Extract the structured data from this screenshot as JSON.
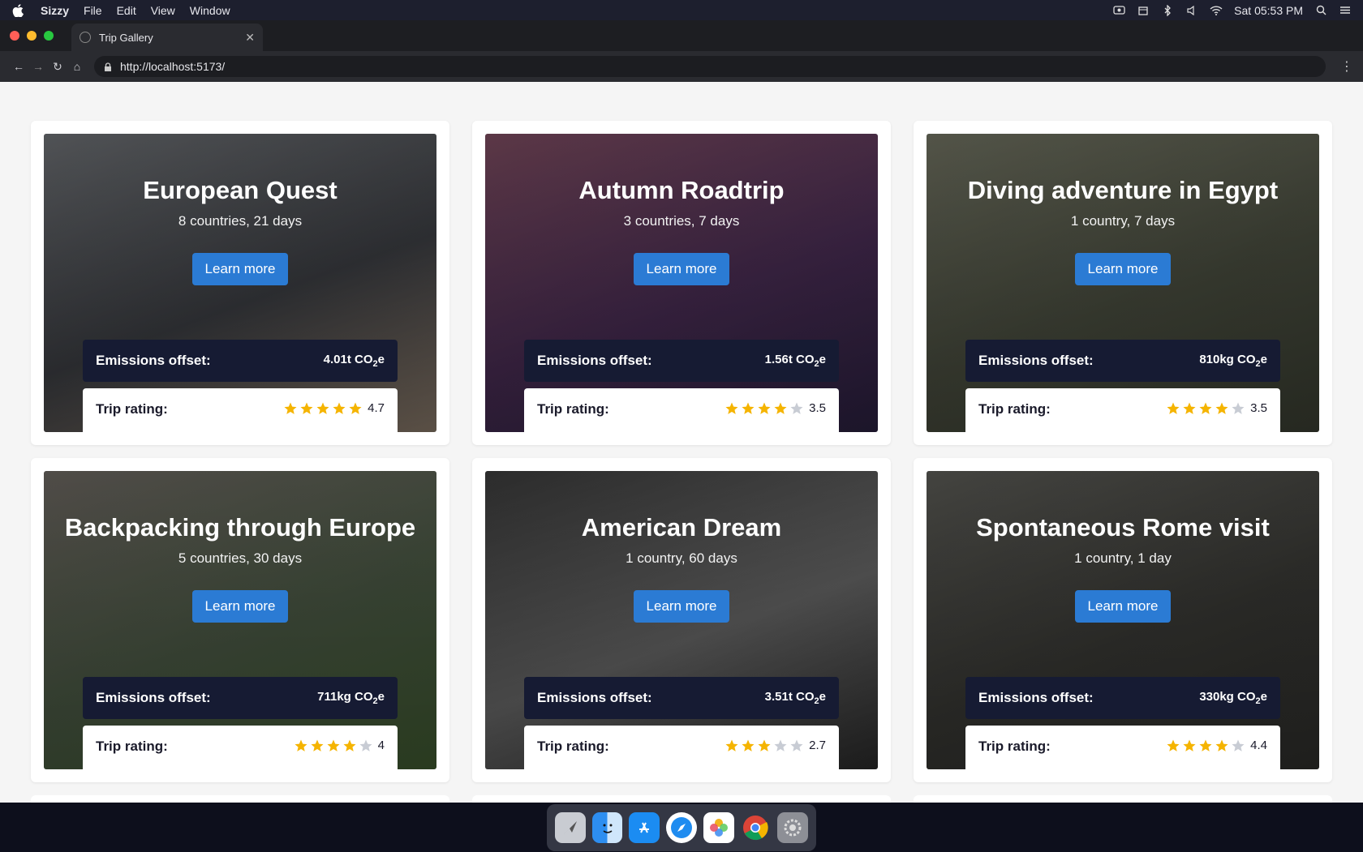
{
  "menubar": {
    "app": "Sizzy",
    "items": [
      "File",
      "Edit",
      "View",
      "Window"
    ],
    "clock": "Sat 05:53 PM"
  },
  "browser": {
    "tab_title": "Trip Gallery",
    "url": "http://localhost:5173/"
  },
  "labels": {
    "learn_more": "Learn more",
    "emissions": "Emissions offset:",
    "rating": "Trip rating:",
    "co2_unit": "CO",
    "co2_sub": "2",
    "co2_suffix": "e"
  },
  "trips": [
    {
      "title": "European Quest",
      "subtitle": "8 countries, 21 days",
      "emissions": "4.01t",
      "rating": "4.7",
      "stars": 4.7,
      "bg": [
        "#6b6e72",
        "#3d3f44",
        "#8a7a6a"
      ]
    },
    {
      "title": "Autumn Roadtrip",
      "subtitle": "3 countries, 7 days",
      "emissions": "1.56t",
      "rating": "3.5",
      "stars": 3.5,
      "bg": [
        "#7a4a5e",
        "#4a2d55",
        "#2a2040"
      ]
    },
    {
      "title": "Diving adventure in Egypt",
      "subtitle": "1 country, 7 days",
      "emissions": "810kg",
      "rating": "3.5",
      "stars": 3.5,
      "bg": [
        "#6e7060",
        "#4a4e40",
        "#3a3e32"
      ]
    },
    {
      "title": "Backpacking through Europe",
      "subtitle": "5 countries, 30 days",
      "emissions": "711kg",
      "rating": "4",
      "stars": 4,
      "bg": [
        "#6a6560",
        "#4b5a45",
        "#3f5a30"
      ]
    },
    {
      "title": "American Dream",
      "subtitle": "1 country, 60 days",
      "emissions": "3.51t",
      "rating": "2.7",
      "stars": 2.7,
      "bg": [
        "#3a3a3a",
        "#6a6a6a",
        "#2a2a2a"
      ]
    },
    {
      "title": "Spontaneous Rome visit",
      "subtitle": "1 country, 1 day",
      "emissions": "330kg",
      "rating": "4.4",
      "stars": 4.4,
      "bg": [
        "#5a5a55",
        "#3a3a36",
        "#2e2e2b"
      ]
    }
  ],
  "colors": {
    "accent": "#2b7bd4",
    "emissions_bg": "#161b33",
    "star_on": "#f5b400",
    "star_off": "#c8ccd4"
  },
  "dock": [
    "launchpad-icon",
    "finder-icon",
    "app-store-icon",
    "safari-icon",
    "photos-icon",
    "chrome-icon",
    "system-preferences-icon"
  ]
}
